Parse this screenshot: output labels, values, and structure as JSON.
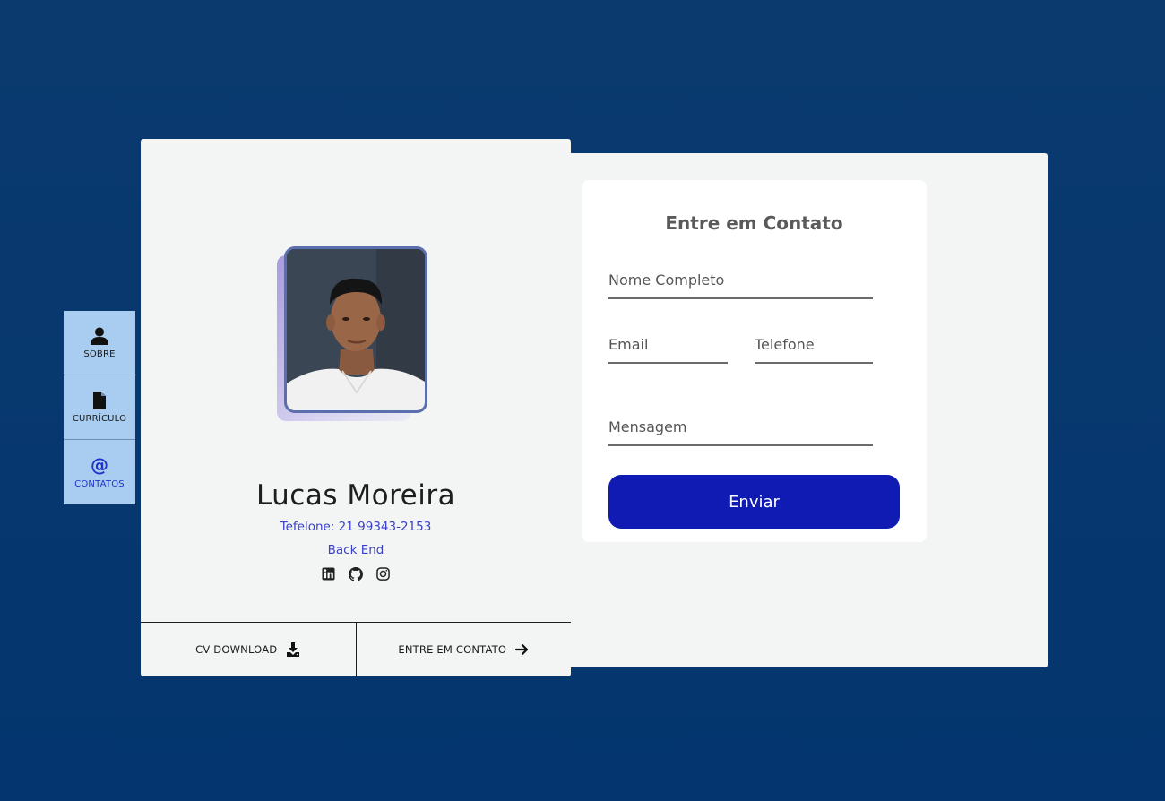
{
  "nav": {
    "items": [
      {
        "label": "SOBRE",
        "icon": "user-icon"
      },
      {
        "label": "CURRÍCULO",
        "icon": "file-icon"
      },
      {
        "label": "CONTATOS",
        "icon": "at-icon",
        "active": true
      }
    ]
  },
  "profile": {
    "name": "Lucas Moreira",
    "phone": "Tefelone: 21 99343-2153",
    "role": "Back End",
    "socials": [
      "linkedin-icon",
      "github-icon",
      "instagram-icon"
    ],
    "footer": {
      "cv_label": "CV DOWNLOAD",
      "contact_label": "ENTRE EM CONTATO"
    }
  },
  "contact_form": {
    "title": "Entre em Contato",
    "nome_placeholder": "Nome Completo",
    "email_placeholder": "Email",
    "telefone_placeholder": "Telefone",
    "mensagem_placeholder": "Mensagem",
    "submit_label": "Enviar"
  },
  "colors": {
    "background": "#04356e",
    "accent": "#101bb3",
    "link": "#3a41c6",
    "nav_bg": "#a9cdf0"
  }
}
